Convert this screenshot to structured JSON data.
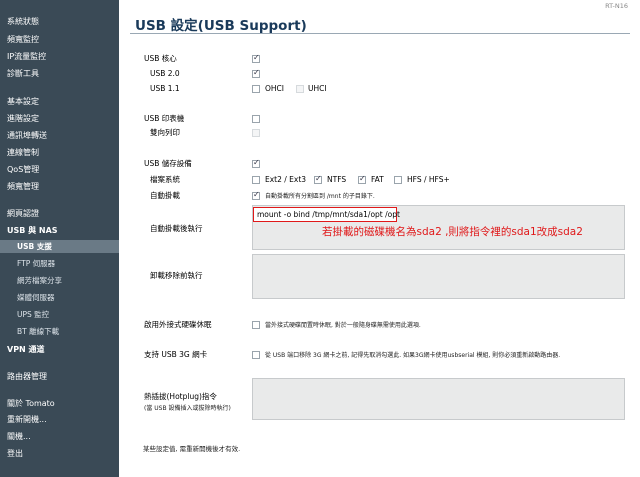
{
  "sidebar": {
    "items": [
      {
        "label": "系統狀態"
      },
      {
        "label": "頻寬監控"
      },
      {
        "label": "IP流量監控"
      },
      {
        "label": "診斷工具"
      },
      {
        "label": "基本設定"
      },
      {
        "label": "進階設定"
      },
      {
        "label": "通訊埠轉送"
      },
      {
        "label": "連線管制"
      },
      {
        "label": "QoS管理"
      },
      {
        "label": "頻寬管理"
      },
      {
        "label": "網頁認證"
      },
      {
        "label": "USB 與 NAS"
      },
      {
        "label": "USB 支援"
      },
      {
        "label": "FTP 伺服器"
      },
      {
        "label": "網芳檔案分享"
      },
      {
        "label": "媒體伺服器"
      },
      {
        "label": "UPS 監控"
      },
      {
        "label": "BT 離線下載"
      },
      {
        "label": "VPN 通道"
      },
      {
        "label": "路由器管理"
      },
      {
        "label": "關於 Tomato"
      },
      {
        "label": "重新開機..."
      },
      {
        "label": "關機..."
      },
      {
        "label": "登出"
      }
    ]
  },
  "header": {
    "title": "USB 設定(USB Support)",
    "model": "RT-N16"
  },
  "form": {
    "usb_core": {
      "label": "USB 核心",
      "checked": true
    },
    "usb20": {
      "label": "USB 2.0",
      "checked": true
    },
    "usb11": {
      "label": "USB 1.1",
      "ohci": "OHCI",
      "uhci": "UHCI"
    },
    "printer": {
      "label": "USB 印表機"
    },
    "bidirectional": {
      "label": "雙向列印"
    },
    "storage": {
      "label": "USB 儲存設備",
      "checked": true
    },
    "filesystem": {
      "label": "檔案系統",
      "ext": "Ext2 / Ext3",
      "ntfs": "NTFS",
      "fat": "FAT",
      "hfs": "HFS / HFS+"
    },
    "automount": {
      "label": "自動掛載",
      "hint": "自動掛載所有分割區到 /mnt 的子目錄下."
    },
    "after_mount": {
      "label": "自動掛載後執行",
      "command": "mount -o bind /tmp/mnt/sda1/opt /opt",
      "note": "若掛載的磁碟機名為sda2 ,則將指令裡的sda1改成sda2"
    },
    "before_unmount": {
      "label": "卸載移除前執行"
    },
    "hdd_spindown": {
      "label": "啟用外接式硬碟休眠",
      "hint": "當外接式硬碟閒置時休眠, 對於一般隨身碟無需使用此選項."
    },
    "usb3g": {
      "label": "支持 USB 3G 網卡",
      "hint": "從 USB 端口移除 3G 網卡之前, 記得先取消勾選此. 如果3G網卡使用usbserial 模組, 則你必須重新啟動路由器."
    },
    "hotplug": {
      "label": "熱插拔(Hotplug)指令",
      "sublabel": "(當 USB 設備插入或拔除時執行)"
    },
    "footer_note": "某些設定值, 需重新開機後才有效."
  }
}
